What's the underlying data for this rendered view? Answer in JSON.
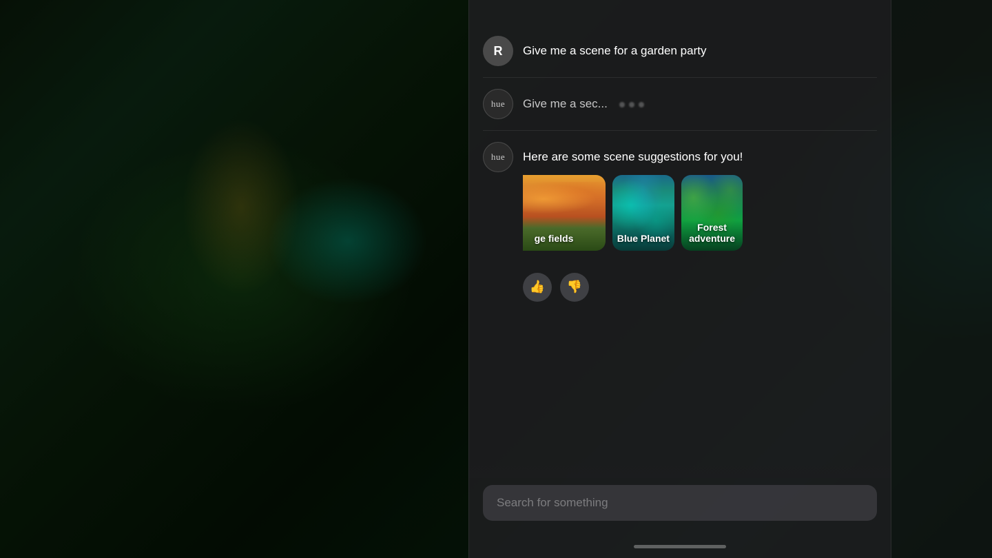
{
  "background": {
    "description": "Outdoor garden patio at night with teal/cyan lighting"
  },
  "chat": {
    "messages": [
      {
        "id": "msg1",
        "sender": "user",
        "avatar_label": "R",
        "text": "Give me a scene for a garden party"
      },
      {
        "id": "msg2",
        "sender": "hue",
        "avatar_label": "hue",
        "text": "Give me a sec..."
      },
      {
        "id": "msg3",
        "sender": "hue",
        "avatar_label": "hue",
        "text": "Here are some scene suggestions for you!"
      }
    ],
    "scene_cards": [
      {
        "id": "card1",
        "label": "ge fields",
        "style": "orange",
        "full_label": "Orange fields"
      },
      {
        "id": "card2",
        "label": "Blue Planet",
        "style": "blue"
      },
      {
        "id": "card3",
        "label": "Forest adventure",
        "style": "forest"
      }
    ],
    "feedback": {
      "thumbs_up": "👍",
      "thumbs_down": "👎"
    }
  },
  "search": {
    "placeholder": "Search for something"
  },
  "home_indicator": {
    "visible": true
  }
}
